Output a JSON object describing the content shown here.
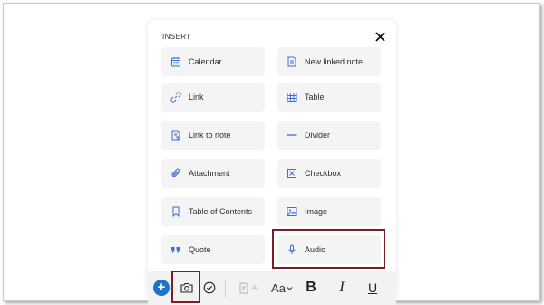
{
  "panel": {
    "title": "INSERT",
    "close_icon": "close-icon"
  },
  "insert_items": [
    {
      "label": "Calendar",
      "icon": "calendar-icon"
    },
    {
      "label": "New linked note",
      "icon": "new-linked-note-icon"
    },
    {
      "label": "Link",
      "icon": "link-icon"
    },
    {
      "label": "Table",
      "icon": "table-icon"
    },
    {
      "label": "Link to note",
      "icon": "link-to-note-icon"
    },
    {
      "label": "Divider",
      "icon": "divider-icon"
    },
    {
      "label": "Attachment",
      "icon": "paperclip-icon"
    },
    {
      "label": "Checkbox",
      "icon": "checkbox-icon"
    },
    {
      "label": "Table of Contents",
      "icon": "bookmark-icon"
    },
    {
      "label": "Image",
      "icon": "image-icon"
    },
    {
      "label": "Quote",
      "icon": "quote-icon"
    },
    {
      "label": "Audio",
      "icon": "microphone-icon"
    }
  ],
  "toolbar": {
    "plus": "+",
    "ai_label": "AI",
    "font_label": "Aa",
    "bold_label": "B",
    "italic_label": "I",
    "underline_label": "U"
  },
  "colors": {
    "accent": "#1f73c8",
    "icon_blue": "#3d6fd6",
    "highlight": "#7a1d24",
    "tile_bg": "#f4f4f5"
  }
}
